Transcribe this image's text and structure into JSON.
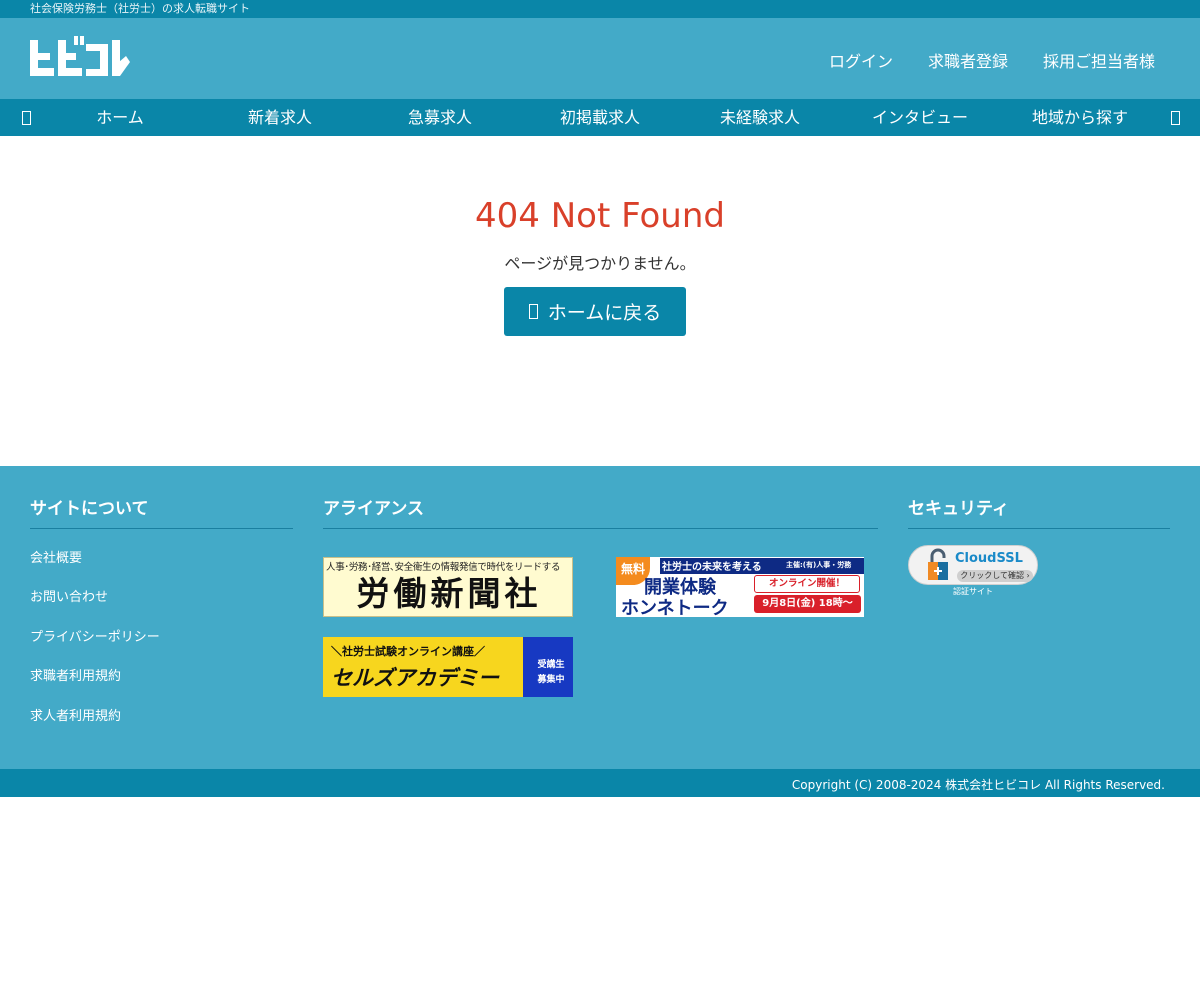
{
  "topbar": {
    "tagline": "社会保険労務士（社労士）の求人転職サイト"
  },
  "header": {
    "logo_text": "ヒビコレ",
    "nav": [
      {
        "label": "ログイン"
      },
      {
        "label": "求職者登録"
      },
      {
        "label": "採用ご担当者様"
      }
    ]
  },
  "navbar": {
    "items": [
      {
        "label": "ホーム"
      },
      {
        "label": "新着求人"
      },
      {
        "label": "急募求人"
      },
      {
        "label": "初掲載求人"
      },
      {
        "label": "未経験求人"
      },
      {
        "label": "インタビュー"
      },
      {
        "label": "地域から探す"
      }
    ]
  },
  "main": {
    "title": "404 Not Found",
    "message": "ページが見つかりません。",
    "home_button": "ホームに戻る"
  },
  "footer": {
    "about": {
      "title": "サイトについて",
      "links": [
        {
          "label": "会社概要"
        },
        {
          "label": "お問い合わせ"
        },
        {
          "label": "プライバシーポリシー"
        },
        {
          "label": "求職者利用規約"
        },
        {
          "label": "求人者利用規約"
        }
      ]
    },
    "alliance": {
      "title": "アライアンス",
      "banner1": {
        "top": "人事･労務･経営､安全衛生の情報発信で時代をリードする",
        "main": "労働新聞社"
      },
      "banner2": {
        "badge": "無料",
        "top": "社労士の未来を考える",
        "host": "主催:(有)人事・労務",
        "main1": "開業体験",
        "main2": "ホンネトーク",
        "online": "オンライン開催！",
        "date": "9月8日(金) 18時～"
      },
      "banner3": {
        "top": "＼社労士試験オンライン講座／",
        "main": "セルズアカデミー",
        "side1": "受講生",
        "side2": "募集中"
      }
    },
    "security": {
      "title": "セキュリティ",
      "badge_title": "CloudSSL",
      "badge_sub": "クリックして確認 ›",
      "badge_note": "認証サイト"
    }
  },
  "copyright": "Copyright (C) 2008-2024 株式会社ヒビコレ All Rights Reserved.",
  "colors": {
    "header_bg": "#43aac8",
    "nav_bg": "#0a86a8",
    "error_title": "#d9402a"
  }
}
